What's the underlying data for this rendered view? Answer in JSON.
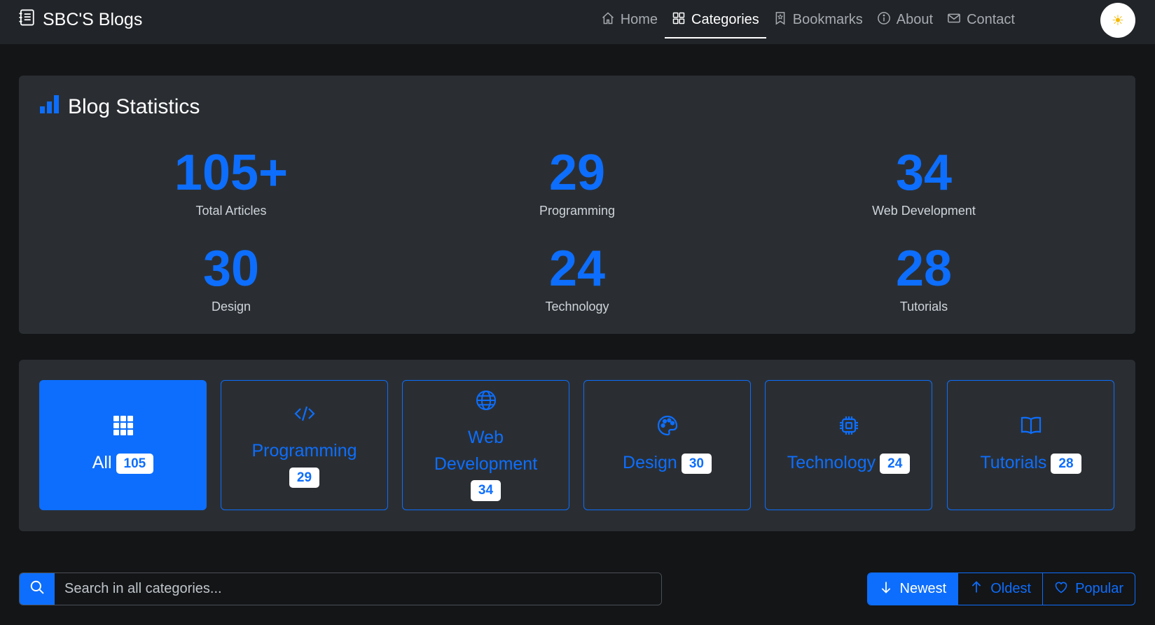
{
  "brand": {
    "name": "SBC'S Blogs",
    "icon": "journal-text-icon"
  },
  "nav": {
    "items": [
      {
        "label": "Home",
        "icon": "house-icon",
        "active": false
      },
      {
        "label": "Categories",
        "icon": "grid-icon",
        "active": true
      },
      {
        "label": "Bookmarks",
        "icon": "bookmark-icon",
        "active": false
      },
      {
        "label": "About",
        "icon": "info-circle-icon",
        "active": false
      },
      {
        "label": "Contact",
        "icon": "envelope-icon",
        "active": false
      }
    ],
    "theme_toggle_icon": "☀"
  },
  "stats": {
    "title": "Blog Statistics",
    "items": [
      {
        "value": "105+",
        "label": "Total Articles"
      },
      {
        "value": "29",
        "label": "Programming"
      },
      {
        "value": "34",
        "label": "Web Development"
      },
      {
        "value": "30",
        "label": "Design"
      },
      {
        "value": "24",
        "label": "Technology"
      },
      {
        "value": "28",
        "label": "Tutorials"
      }
    ]
  },
  "categories": [
    {
      "label": "All",
      "count": "105",
      "icon": "grid-3x3-icon",
      "active": true
    },
    {
      "label": "Programming",
      "count": "29",
      "icon": "code-slash-icon",
      "active": false
    },
    {
      "label_line1": "Web",
      "label_line2": "Development",
      "count": "34",
      "icon": "globe-icon",
      "active": false
    },
    {
      "label": "Design",
      "count": "30",
      "icon": "palette-icon",
      "active": false
    },
    {
      "label": "Technology",
      "count": "24",
      "icon": "cpu-icon",
      "active": false
    },
    {
      "label": "Tutorials",
      "count": "28",
      "icon": "book-icon",
      "active": false
    }
  ],
  "search": {
    "placeholder": "Search in all categories...",
    "value": ""
  },
  "sort": {
    "options": [
      {
        "label": "Newest",
        "icon": "arrow-down-icon",
        "active": true
      },
      {
        "label": "Oldest",
        "icon": "arrow-up-icon",
        "active": false
      },
      {
        "label": "Popular",
        "icon": "heart-icon",
        "active": false
      }
    ]
  },
  "colors": {
    "accent": "#0d6efd",
    "navbar_bg": "#212428",
    "card_bg": "#2a2e33",
    "page_bg": "#141517"
  }
}
